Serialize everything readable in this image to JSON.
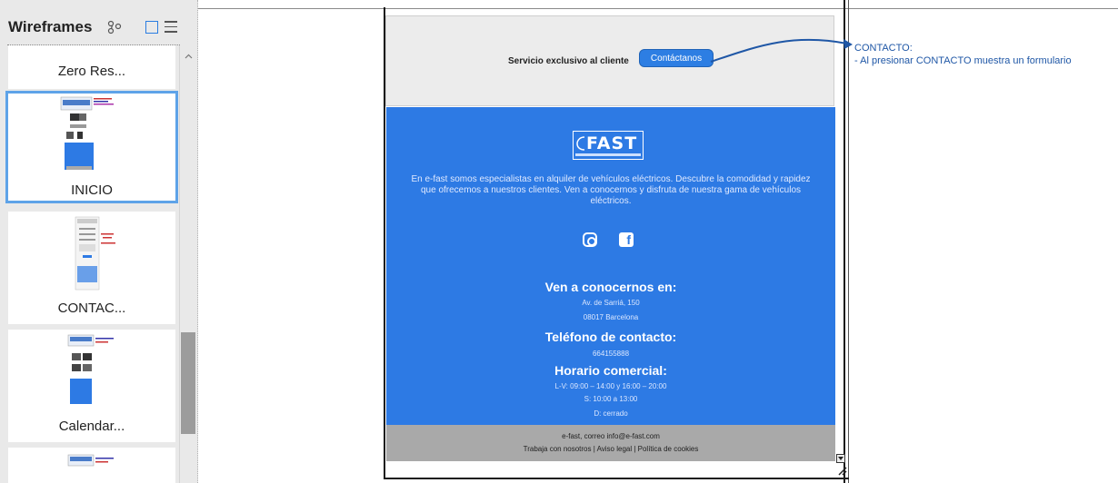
{
  "sidebar": {
    "title": "Wireframes",
    "thumbnails": [
      {
        "label": "Zero Res..."
      },
      {
        "label": "INICIO",
        "selected": true
      },
      {
        "label": "CONTAC..."
      },
      {
        "label": "Calendar..."
      }
    ]
  },
  "wireframe": {
    "contact_band": {
      "text": "Servicio exclusivo al cliente",
      "button_label": "Contáctanos"
    },
    "footer": {
      "logo_text": "FAST",
      "description": "En e-fast somos especialistas en alquiler de vehículos eléctricos. Descubre la comodidad y rapidez que ofrecemos a nuestros clientes. Ven a conocernos y disfruta de nuestra gama de vehículos eléctricos.",
      "social_icons": [
        "instagram-icon",
        "facebook-icon"
      ],
      "visit_heading": "Ven a conocernos en:",
      "address_line1": "Av. de Sarriá, 150",
      "address_line2": "08017 Barcelona",
      "phone_heading": "Teléfono de contacto:",
      "phone": "664155888",
      "hours_heading": "Horario comercial:",
      "hours_line1": "L-V: 09:00 – 14:00 y 16:00 – 20:00",
      "hours_line2": "S: 10:00 a 13:00",
      "hours_line3": "D: cerrado",
      "bottom_line1": "e-fast, correo info@e-fast.com",
      "bottom_line2": "Trabaja con nosotros | Aviso legal | Política de cookies"
    }
  },
  "annotation": {
    "title": "CONTACTO:",
    "body": "- Al presionar CONTACTO muestra un formulario"
  },
  "colors": {
    "accent": "#2d7ae4",
    "selection": "#5ea3e8",
    "annotation": "#1f57a6"
  }
}
